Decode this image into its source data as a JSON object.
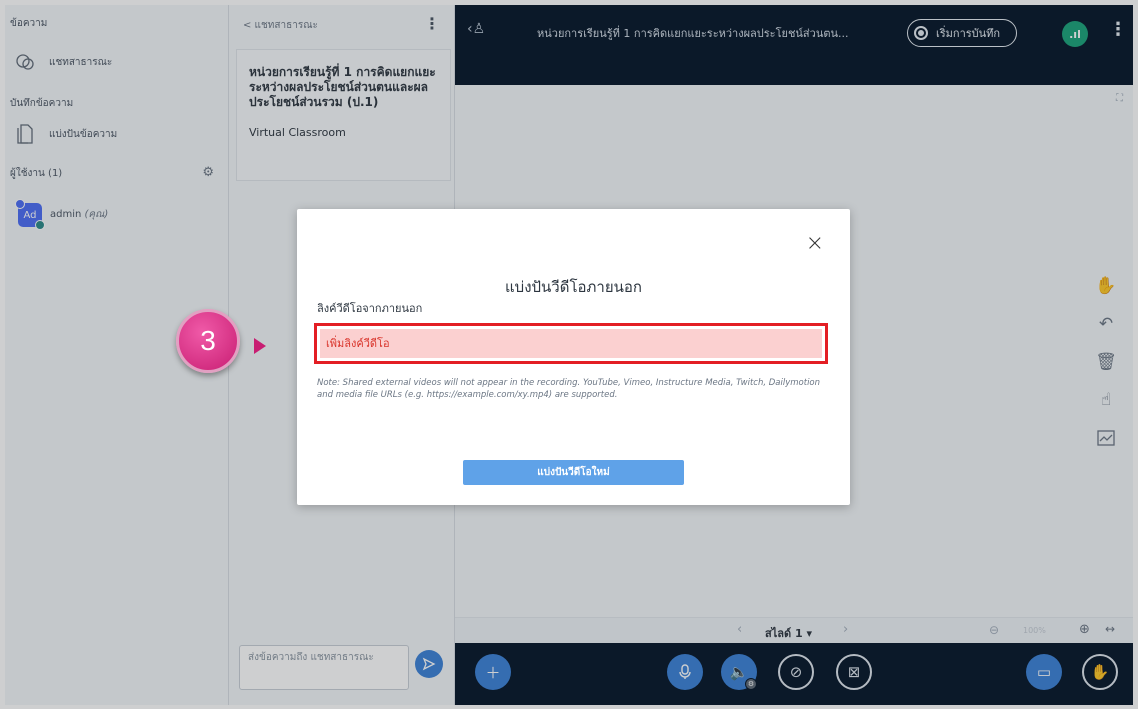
{
  "sidebar": {
    "messages_heading": "ข้อความ",
    "public_chat_label": "แชทสาธารณะ",
    "notes_heading": "บันทึกข้อความ",
    "shared_notes_label": "แบ่งปันข้อความ",
    "users_heading": "ผู้ใช้งาน (1)",
    "user": {
      "initials": "Ad",
      "name": "admin",
      "you_label": "(คุณ)"
    }
  },
  "chat": {
    "back_label": "< แชทสาธารณะ",
    "welcome_title": "หน่วยการเรียนรู้ที่ 1 การคิดแยกแยะระหว่างผลประโยชน์ส่วนตนและผลประโยชน์ส่วนรวม (ป.1)",
    "welcome_sub": "Virtual Classroom",
    "input_placeholder": "ส่งข้อความถึง แชทสาธารณะ"
  },
  "topbar": {
    "title": "หน่วยการเรียนรู้ที่ 1 การคิดแยกแยะระหว่างผลประโยชน์ส่วนตน...",
    "record_label": "เริ่มการบันทึก",
    "connection_label": ".ıl"
  },
  "slides": {
    "current_label": "สไลด์ 1 ▾",
    "zoom_value": "100%"
  },
  "modal": {
    "title": "แบ่งปันวีดีโอภายนอก",
    "field_label": "ลิงค์วีดีโอจากภายนอก",
    "input_placeholder": "เพิ่มลิงค์วีดีโอ",
    "note": "Note: Shared external videos will not appear in the recording. YouTube, Vimeo, Instructure Media, Twitch, Dailymotion and media file URLs (e.g. https://example.com/xy.mp4) are supported.",
    "share_button": "แบ่งปันวีดีโอใหม่",
    "close_icon": "×"
  },
  "step_marker": {
    "number": "3"
  },
  "colors": {
    "accent": "#3b82d8",
    "dark": "#06172a",
    "highlight": "#e31e24",
    "marker": "#c81d72"
  }
}
